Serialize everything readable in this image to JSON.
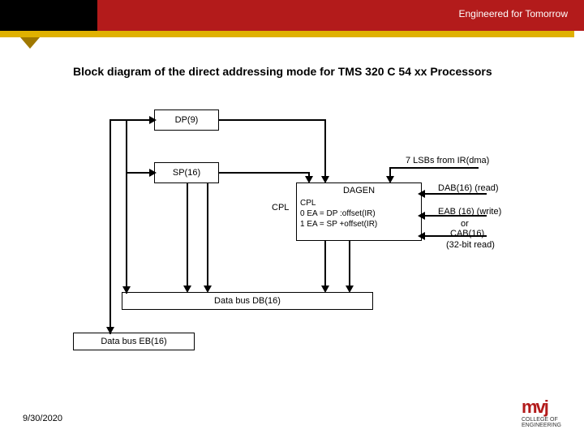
{
  "header": {
    "tagline": "Engineered for Tomorrow"
  },
  "title": "Block diagram of the direct addressing mode for TMS 320 C 54 xx Processors",
  "blocks": {
    "dp": "DP(9)",
    "sp": "SP(16)",
    "dagen_title": "DAGEN",
    "dagen_cpl": "CPL",
    "dagen_line0": "0   EA = DP :offset(IR)",
    "dagen_line1": "1   EA = SP +offset(IR)",
    "db": "Data bus  DB(16)",
    "eb": "Data bus EB(16)"
  },
  "labels": {
    "cpl_left": "CPL",
    "lsbs": "7 LSBs from IR(dma)",
    "dab": "DAB(16) (read)",
    "eab": "EAB (16) (write)",
    "or": "or",
    "cab": "CAB(16)",
    "cab2": "(32-bit read)"
  },
  "footer": {
    "date": "9/30/2020",
    "logo_main": "mvj",
    "logo_sub1": "COLLEGE OF",
    "logo_sub2": "ENGINEERING"
  }
}
